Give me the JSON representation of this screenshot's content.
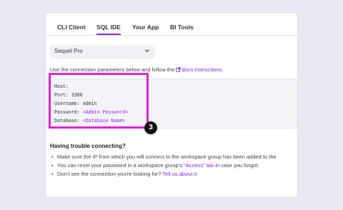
{
  "tabs": [
    {
      "label": "CLI Client",
      "active": false
    },
    {
      "label": "SQL IDE",
      "active": true
    },
    {
      "label": "Your App",
      "active": false
    },
    {
      "label": "BI Tools",
      "active": false
    }
  ],
  "client_select": {
    "value": "Sequel Pro"
  },
  "instructions": {
    "prefix": "Use the connection parameters below and follow the",
    "link_text": "docs instructions",
    "suffix": "."
  },
  "connection": {
    "host_label": "Host:",
    "port_label": "Port:",
    "port_value": "3306",
    "username_label": "Username:",
    "username_value": "admin",
    "password_label": "Password:",
    "password_value": "<Admin Password>",
    "database_label": "Database:",
    "database_value": "<Database Name>"
  },
  "step_badge": "3",
  "trouble": {
    "title": "Having trouble connecting?",
    "bullet1": "Make sure the IP from which you will connect to the workspace group has been added to the",
    "bullet2_prefix": "You can reset your password in a workspace group's",
    "bullet2_link": "\"Access\" tab",
    "bullet2_suffix": "in case you forgot.",
    "bullet3_prefix": "Don't see the connection you're looking for?",
    "bullet3_link": "Tell us about it."
  },
  "colors": {
    "accent": "#8a2be2",
    "highlight": "#e91ed6",
    "background": "#ebe8f3"
  }
}
